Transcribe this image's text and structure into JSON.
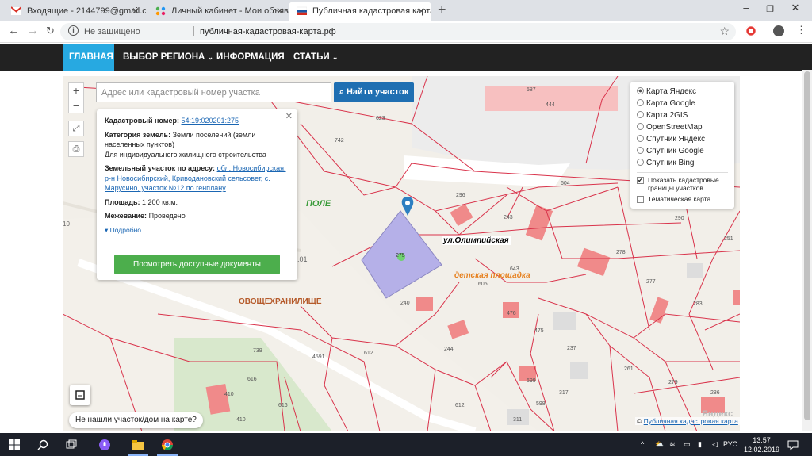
{
  "browser": {
    "tabs": [
      {
        "title": "Входящие - 2144799@gmail.com",
        "active": false
      },
      {
        "title": "Личный кабинет - Мои объявл",
        "active": false
      },
      {
        "title": "Публичная кадастровая карта Р",
        "active": true
      }
    ],
    "insecure_label": "Не защищено",
    "url": "публичная-кадастровая-карта.рф"
  },
  "site_nav": {
    "items": [
      {
        "label": "ГЛАВНАЯ"
      },
      {
        "label": "ВЫБОР РЕГИОНА"
      },
      {
        "label": "ИНФОРМАЦИЯ"
      },
      {
        "label": "СТАТЬИ"
      }
    ]
  },
  "map": {
    "search_placeholder": "Адрес или кадастровый номер участка",
    "search_button": "Найти участок",
    "zoom_in": "+",
    "zoom_out": "−",
    "not_found_label": "Не нашли участок/дом на карте?",
    "copyright_symbol": "©",
    "copyright_link": "Публичная кадастровая карта",
    "provider_watermark": "Яндекс",
    "labels": {
      "pole": "ПОЛЕ",
      "ovoshch": "ОВОЩЕХРАНИЛИЩЕ",
      "street": "ул.Олимпийская",
      "playground": "детская площадка",
      "code_01": ".01",
      "left_10": "10"
    },
    "parcel_numbers": [
      "587",
      "444",
      "623",
      "742",
      "296",
      "604",
      "243",
      "290",
      "251",
      "278",
      "277",
      "240",
      "605",
      "643",
      "283",
      "476",
      "475",
      "237",
      "612",
      "244",
      "739",
      "4591",
      "616",
      "410",
      "599",
      "317",
      "261",
      "279",
      "286",
      "311",
      "598",
      "616",
      "612",
      "410"
    ]
  },
  "info_panel": {
    "cadastral_label": "Кадастровый номер:",
    "cadastral_value": "54:19:020201:275",
    "category_label": "Категория земель:",
    "category_value": "Земли поселений (земли населенных пунктов)",
    "use_value": "Для индивидуального жилищного строительства",
    "address_label": "Земельный участок по адресу:",
    "address_value": "обл. Новосибирская, р-н Новосибирский, Криводановский сельсовет, с. Марусино, участок №12 по генплану",
    "area_label": "Площадь:",
    "area_value": "1 200 кв.м.",
    "survey_label": "Межевание:",
    "survey_value": "Проведено",
    "more_label": "Подробно",
    "docs_button": "Посмотреть доступные документы",
    "parcel_id": "275"
  },
  "layers": {
    "options": [
      {
        "label": "Карта Яндекс",
        "selected": true
      },
      {
        "label": "Карта Google",
        "selected": false
      },
      {
        "label": "Карта 2GIS",
        "selected": false
      },
      {
        "label": "OpenStreetMap",
        "selected": false
      },
      {
        "label": "Спутник Яндекс",
        "selected": false
      },
      {
        "label": "Спутник Google",
        "selected": false
      },
      {
        "label": "Спутник Bing",
        "selected": false
      }
    ],
    "show_borders_label": "Показать кадастровые границы участков",
    "show_borders_checked": true,
    "thematic_label": "Тематическая карта",
    "thematic_checked": false
  },
  "taskbar": {
    "language": "РУС",
    "time": "13:57",
    "date": "12.02.2019"
  },
  "colors": {
    "nav_bg": "#222222",
    "nav_accent": "#27a9e1",
    "search_btn": "#1f6fb2",
    "docs_btn": "#4cae4c",
    "parcel_border": "#d9334b",
    "selected_parcel": "#b5b0e8"
  }
}
